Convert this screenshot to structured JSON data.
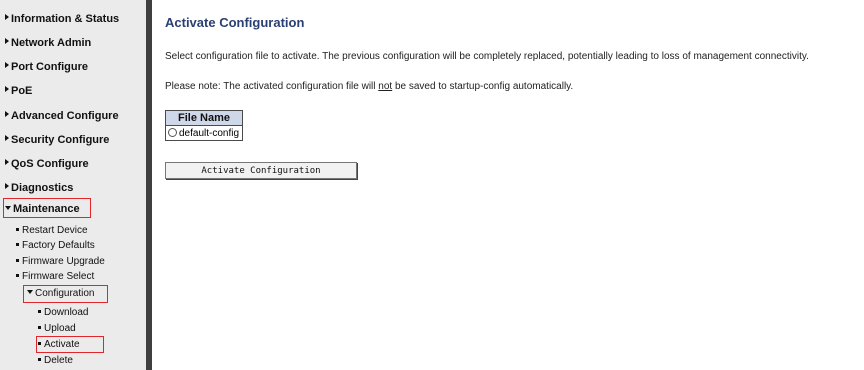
{
  "sidebar": {
    "items": [
      {
        "label": "Information & Status"
      },
      {
        "label": "Network Admin"
      },
      {
        "label": "Port Configure"
      },
      {
        "label": "PoE"
      },
      {
        "label": "Advanced Configure"
      },
      {
        "label": "Security Configure"
      },
      {
        "label": "QoS Configure"
      },
      {
        "label": "Diagnostics"
      },
      {
        "label": "Maintenance"
      }
    ],
    "maintenance_sub": [
      {
        "label": "Restart Device"
      },
      {
        "label": "Factory Defaults"
      },
      {
        "label": "Firmware Upgrade"
      },
      {
        "label": "Firmware Select"
      }
    ],
    "configuration": {
      "label": "Configuration"
    },
    "configuration_sub": [
      {
        "label": "Download"
      },
      {
        "label": "Upload"
      },
      {
        "label": "Activate"
      },
      {
        "label": "Delete"
      }
    ]
  },
  "main": {
    "title": "Activate Configuration",
    "description": "Select configuration file to activate. The previous configuration will be completely replaced, potentially leading to loss of management connectivity.",
    "note_prefix": "Please note: The activated configuration file will ",
    "note_emph": "not",
    "note_suffix": " be saved to startup-config automatically.",
    "table": {
      "header": "File Name",
      "rows": [
        {
          "name": "default-config"
        }
      ]
    },
    "activate_button": "Activate Configuration"
  },
  "colors": {
    "sidebar_bg": "#ebebeb",
    "divider": "#3f3f3f",
    "title": "#2a3f72",
    "highlight": "#e0262a",
    "table_header_bg": "#cfd8e8"
  }
}
